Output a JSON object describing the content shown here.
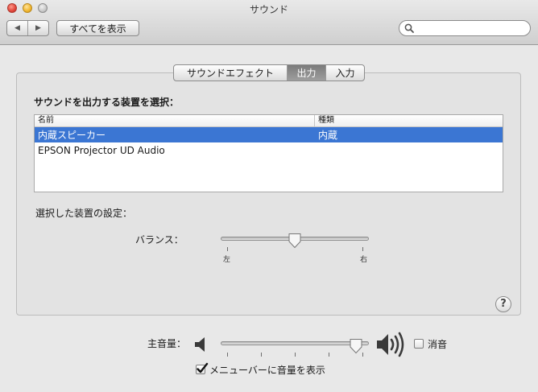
{
  "window": {
    "title": "サウンド"
  },
  "toolbar": {
    "back_glyph": "◀",
    "forward_glyph": "▶",
    "show_all": "すべてを表示",
    "search_value": "",
    "search_placeholder": ""
  },
  "tabs": [
    {
      "label": "サウンドエフェクト",
      "active": false
    },
    {
      "label": "出力",
      "active": true
    },
    {
      "label": "入力",
      "active": false
    }
  ],
  "output": {
    "heading": "サウンドを出力する装置を選択：",
    "columns": [
      "名前",
      "種類"
    ],
    "devices": [
      {
        "name": "内蔵スピーカー",
        "type": "内蔵",
        "selected": true
      },
      {
        "name": "EPSON Projector UD Audio",
        "type": "",
        "selected": false
      }
    ],
    "settings_label": "選択した装置の設定：",
    "balance_label": "バランス：",
    "balance_left": "左",
    "balance_right": "右",
    "balance_value": 0.5
  },
  "help": {
    "glyph": "?"
  },
  "volume": {
    "label": "主音量：",
    "value": 0.95,
    "mute_label": "消音",
    "muted": false,
    "show_in_menubar_label": "メニューバーに音量を表示",
    "show_in_menubar": true
  },
  "colors": {
    "selection": "#3b76d3",
    "active_tab": "#8a8a8a"
  }
}
